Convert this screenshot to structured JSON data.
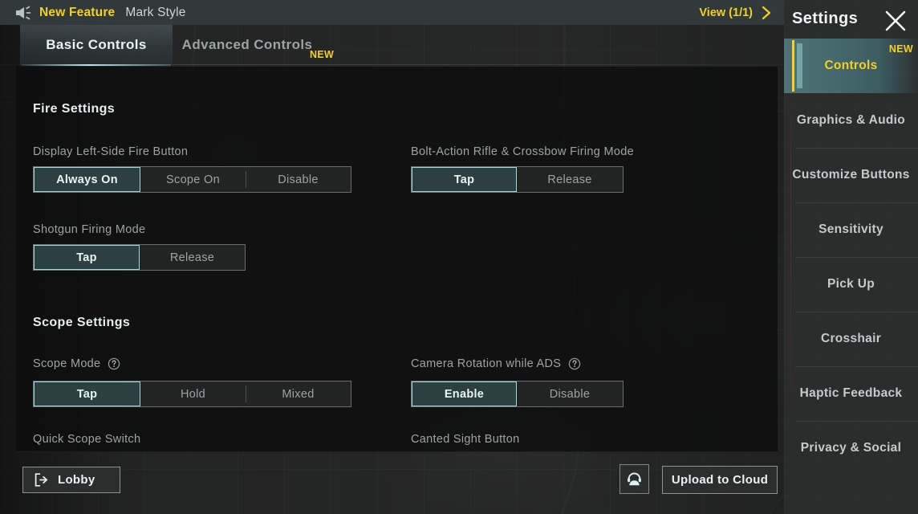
{
  "topbar": {
    "speaker_icon": "speaker-announcement-icon",
    "feature_tag": "New Feature",
    "feature_text": "Mark Style",
    "view_label": "View (1/1)",
    "chevron_icon": "chevron-right-icon"
  },
  "tabs": [
    {
      "label": "Basic Controls",
      "active": true
    },
    {
      "label": "Advanced Controls",
      "active": false,
      "badge": "NEW"
    }
  ],
  "sections": [
    {
      "title": "Fire Settings",
      "rows": [
        {
          "label": "Display Left-Side Fire Button",
          "help": false,
          "options": [
            "Always On",
            "Scope On",
            "Disable"
          ],
          "selected": "Always On"
        },
        {
          "label": "Bolt-Action Rifle & Crossbow Firing Mode",
          "help": false,
          "options": [
            "Tap",
            "Release"
          ],
          "selected": "Tap"
        },
        {
          "label": "Shotgun Firing Mode",
          "help": false,
          "options": [
            "Tap",
            "Release"
          ],
          "selected": "Tap"
        }
      ]
    },
    {
      "title": "Scope Settings",
      "rows": [
        {
          "label": "Scope Mode",
          "help": true,
          "options": [
            "Tap",
            "Hold",
            "Mixed"
          ],
          "selected": "Tap"
        },
        {
          "label": "Camera Rotation while ADS",
          "help": true,
          "options": [
            "Enable",
            "Disable"
          ],
          "selected": "Enable"
        },
        {
          "label": "Quick Scope Switch",
          "help": false,
          "options": [],
          "selected": ""
        },
        {
          "label": "Canted Sight Button",
          "help": false,
          "options": [],
          "selected": ""
        }
      ]
    }
  ],
  "bottom": {
    "lobby_label": "Lobby",
    "lobby_icon": "exit-door-icon",
    "support_icon": "headset-person-icon",
    "upload_label": "Upload to Cloud"
  },
  "sidebar": {
    "title": "Settings",
    "close_icon": "close-icon",
    "items": [
      {
        "label": "Controls",
        "active": true,
        "badge": "NEW"
      },
      {
        "label": "Graphics & Audio",
        "active": false
      },
      {
        "label": "Customize Buttons",
        "active": false
      },
      {
        "label": "Sensitivity",
        "active": false
      },
      {
        "label": "Pick Up",
        "active": false
      },
      {
        "label": "Crosshair",
        "active": false
      },
      {
        "label": "Haptic Feedback",
        "active": false
      },
      {
        "label": "Privacy & Social",
        "active": false
      }
    ]
  },
  "colors": {
    "accent_yellow": "#f4d022",
    "accent_cyan": "#9fd9e2",
    "selected_fill": "#2c3f41",
    "panel_bg": "#0c0c0c",
    "sidebar_bg": "#2c2d2d",
    "text_primary": "#e6eef0",
    "text_muted": "#9ba3a5"
  }
}
